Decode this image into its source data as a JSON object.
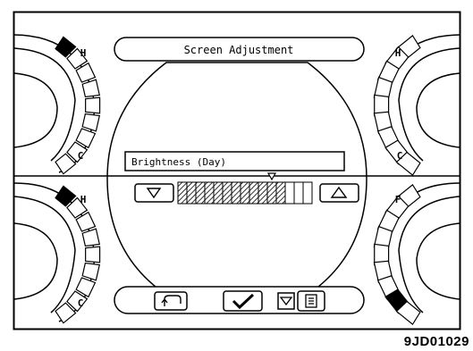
{
  "header": {
    "title": "Screen Adjustment"
  },
  "setting": {
    "label": "Brightness (Day)",
    "total_segments": 15,
    "level": 12,
    "marker_segment": 10,
    "decrease_icon": "triangle-down-icon",
    "increase_icon": "triangle-up-icon"
  },
  "gauges": {
    "top_left": {
      "top_letter": "H",
      "bottom_letter": "C"
    },
    "bottom_left": {
      "top_letter": "H",
      "bottom_letter": "C"
    },
    "top_right": {
      "top_letter": "H",
      "bottom_letter": "C"
    },
    "bottom_right": {
      "top_letter": "F",
      "bottom_letter": "E"
    }
  },
  "footer": {
    "buttons": [
      {
        "name": "back-button",
        "icon": "return-arrow-icon"
      },
      {
        "name": "confirm-button",
        "icon": "checkmark-icon"
      },
      {
        "name": "select-button",
        "icon": "triangle-down-icon"
      },
      {
        "name": "menu-button",
        "icon": "menu-list-icon"
      }
    ]
  },
  "figure_code": "9JD01029"
}
